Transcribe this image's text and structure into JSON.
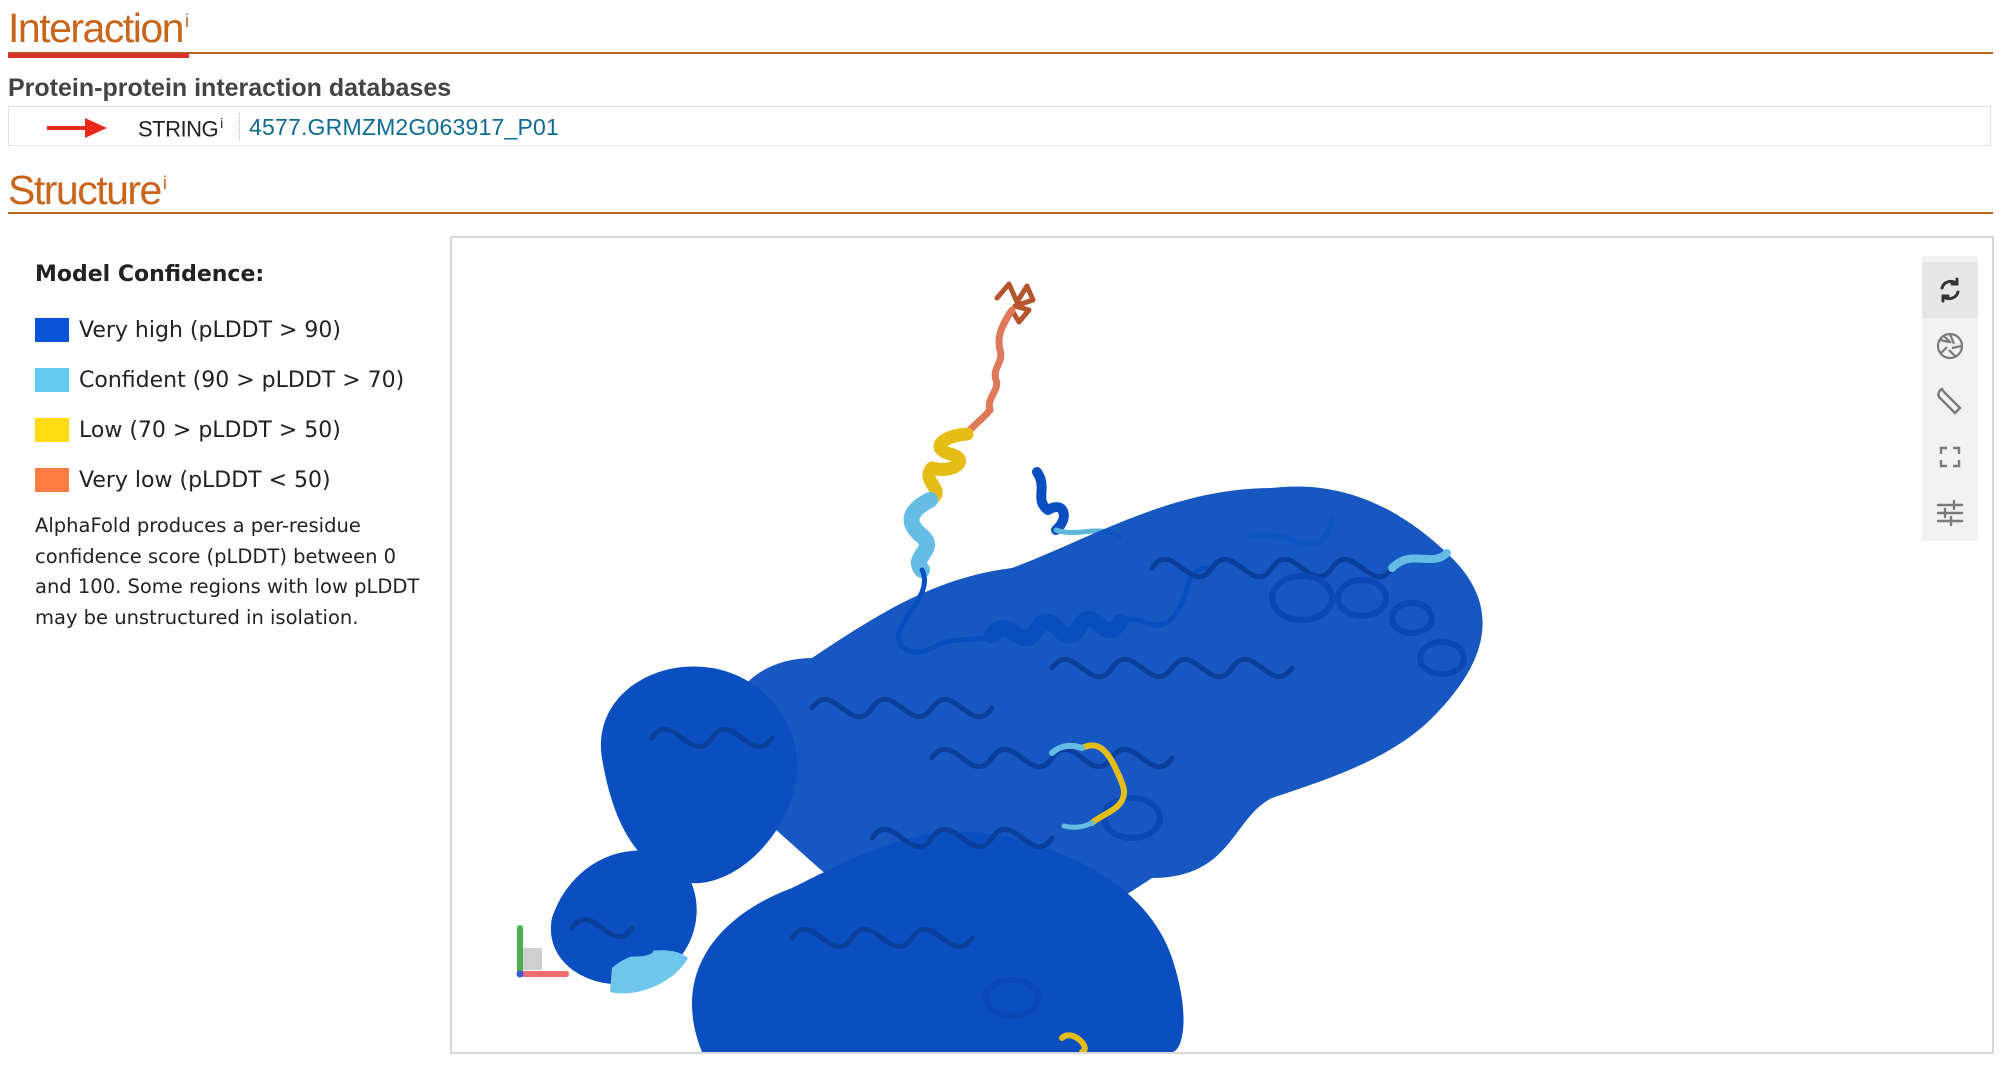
{
  "interaction": {
    "heading": "Interaction",
    "info_marker": "i",
    "ppi_subheading": "Protein-protein interaction databases",
    "databases": [
      {
        "label": "STRING",
        "info_marker": "i",
        "value": "4577.GRMZM2G063917_P01"
      }
    ]
  },
  "structure": {
    "heading": "Structure",
    "info_marker": "i",
    "legend": {
      "title": "Model Confidence:",
      "items": [
        {
          "label": "Very high (pLDDT > 90)",
          "color": "#0a53d6"
        },
        {
          "label": "Confident (90 > pLDDT > 70)",
          "color": "#65cbf3"
        },
        {
          "label": "Low (70 > pLDDT > 50)",
          "color": "#ffdb13"
        },
        {
          "label": "Very low (pLDDT < 50)",
          "color": "#ff7d45"
        }
      ],
      "description": "AlphaFold produces a per-residue confidence score (pLDDT) between 0 and 100. Some regions with low pLDDT may be unstructured in isolation."
    },
    "viewer_tools": [
      {
        "icon": "reset-view-icon"
      },
      {
        "icon": "camera-shutter-icon"
      },
      {
        "icon": "wrench-icon"
      },
      {
        "icon": "fullscreen-icon"
      },
      {
        "icon": "sliders-icon"
      }
    ]
  }
}
